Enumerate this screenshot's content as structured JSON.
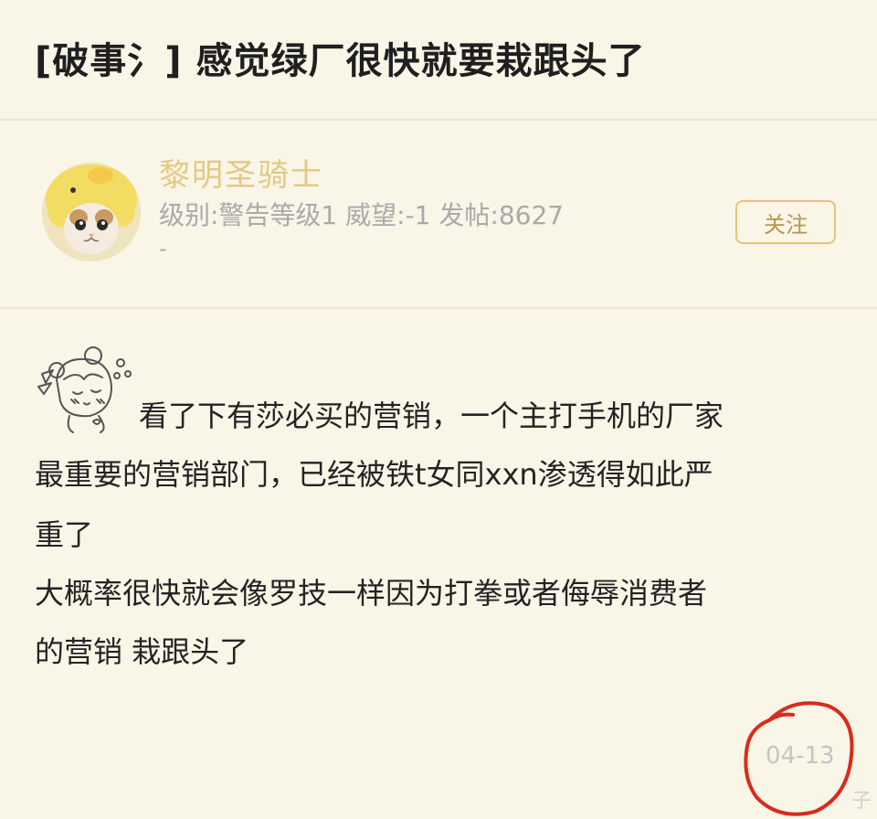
{
  "thread": {
    "title": "[破事氵] 感觉绿厂很快就要栽跟头了"
  },
  "author": {
    "name": "黎明圣骑士",
    "stats": "级别:警告等级1 威望:-1 发帖:8627",
    "signature": "-",
    "follow_label": "关注"
  },
  "post": {
    "lines": [
      "看了下有莎必买的营销，一个主打手机的厂家",
      "最重要的营销部门，已经被铁t女同xxn渗透得如此严",
      "重了",
      "大概率很快就会像罗技一样因为打拳或者侮辱消费者",
      "的营销 栽跟头了"
    ],
    "date": "04-13"
  },
  "colors": {
    "background": "#f9f5e7",
    "username": "#e3c985",
    "accent_border": "#e1c57c",
    "annotation": "#d92b1c"
  },
  "icons": {
    "avatar": "cat-in-yellow-duck-hat",
    "emoticon": "cartoon-girl-emoticon"
  }
}
